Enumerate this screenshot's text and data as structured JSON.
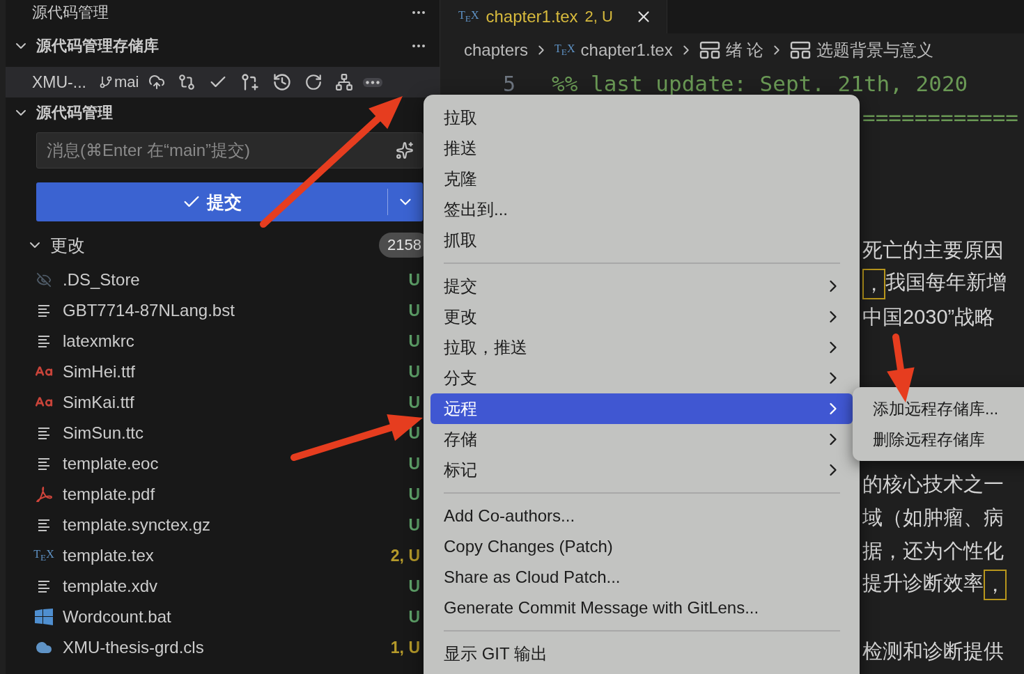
{
  "sidebar": {
    "title": "源代码管理",
    "repositories_section": {
      "title": "源代码管理存储库",
      "expanded": true
    },
    "repository": {
      "name": "XMU-...",
      "branch": "mai",
      "menu_open": true
    },
    "scm_section": {
      "title": "源代码管理",
      "expanded": true
    },
    "message_field": {
      "placeholder": "消息(⌘Enter 在“main”提交)"
    },
    "commit_button": {
      "label": "提交"
    },
    "changes": {
      "title": "更改",
      "count": "2158",
      "expanded": true,
      "files": [
        {
          "kind": "hidden",
          "name": ".DS_Store",
          "status": "U",
          "color": "#5fa36a"
        },
        {
          "kind": "text",
          "name": "GBT7714-87NLang.bst",
          "status": "U",
          "color": "#5fa36a"
        },
        {
          "kind": "text",
          "name": "latexmkrc",
          "status": "U",
          "color": "#5fa36a"
        },
        {
          "kind": "font",
          "name": "SimHei.ttf",
          "status": "U",
          "color": "#5fa36a"
        },
        {
          "kind": "font",
          "name": "SimKai.ttf",
          "status": "U",
          "color": "#5fa36a"
        },
        {
          "kind": "text",
          "name": "SimSun.ttc",
          "status": "U",
          "color": "#5fa36a"
        },
        {
          "kind": "text",
          "name": "template.eoc",
          "status": "U",
          "color": "#5fa36a"
        },
        {
          "kind": "pdf",
          "name": "template.pdf",
          "status": "U",
          "color": "#5fa36a"
        },
        {
          "kind": "text",
          "name": "template.synctex.gz",
          "status": "U",
          "color": "#5fa36a"
        },
        {
          "kind": "tex",
          "icon_text": "T$_{E}$X",
          "name": "template.tex",
          "status": "2, U",
          "color": "#b59a2a"
        },
        {
          "kind": "text",
          "name": "template.xdv",
          "status": "U",
          "color": "#5fa36a"
        },
        {
          "kind": "batch",
          "name": "Wordcount.bat",
          "status": "U",
          "color": "#5fa36a"
        },
        {
          "kind": "class",
          "name": "XMU-thesis-grd.cls",
          "status": "1, U",
          "color": "#b59a2a"
        }
      ]
    }
  },
  "editor": {
    "tabs": [
      {
        "icon_text": "T$_{E}$X",
        "name": "chapter1.tex",
        "status": "2, U",
        "selected": true
      }
    ],
    "breadcrumbs": [
      {
        "kind": "folder",
        "label": "chapters"
      },
      {
        "kind": "file",
        "icon_text": "T$_{E}$X",
        "label": "chapter1.tex"
      },
      {
        "kind": "section",
        "label": "绪 论"
      },
      {
        "kind": "section",
        "label": "选题背景与意义"
      }
    ],
    "lines": [
      {
        "kind": "code",
        "number": "5",
        "text": "%% last update: Sept. 21th, 2020"
      },
      {
        "kind": "rule",
        "text": "============"
      },
      {
        "kind": "blank"
      },
      {
        "kind": "blank"
      },
      {
        "kind": "blank"
      },
      {
        "kind": "prose",
        "segments": [
          {
            "text": "死亡的主要原因",
            "boxed": false
          }
        ]
      },
      {
        "kind": "prose",
        "segments": [
          {
            "text": "，",
            "boxed": true
          },
          {
            "text": "我国每年新增",
            "boxed": false
          }
        ]
      },
      {
        "kind": "prose",
        "segments": [
          {
            "text": "中国2030”战略",
            "boxed": false
          }
        ]
      },
      {
        "kind": "blank"
      },
      {
        "kind": "blank"
      },
      {
        "kind": "blank"
      },
      {
        "kind": "blank"
      },
      {
        "kind": "prose",
        "segments": [
          {
            "text": "的核心技术之一",
            "boxed": false
          }
        ]
      },
      {
        "kind": "prose",
        "segments": [
          {
            "text": "域（如肿瘤、病",
            "boxed": false
          }
        ]
      },
      {
        "kind": "prose",
        "segments": [
          {
            "text": "据，还为个性化",
            "boxed": false
          }
        ]
      },
      {
        "kind": "prose",
        "segments": [
          {
            "text": "提升诊断效率",
            "boxed": false
          },
          {
            "text": "，",
            "boxed": true
          }
        ]
      },
      {
        "kind": "blank"
      },
      {
        "kind": "prose",
        "segments": [
          {
            "text": "检测和诊断提供",
            "boxed": false
          }
        ]
      }
    ]
  },
  "context_menu": {
    "groups": [
      {
        "items": [
          {
            "label": "拉取",
            "submenu": false,
            "selected": false
          },
          {
            "label": "推送",
            "submenu": false,
            "selected": false
          },
          {
            "label": "克隆",
            "submenu": false,
            "selected": false
          },
          {
            "label": "签出到...",
            "submenu": false,
            "selected": false
          },
          {
            "label": "抓取",
            "submenu": false,
            "selected": false
          }
        ]
      },
      {
        "items": [
          {
            "label": "提交",
            "submenu": true,
            "selected": false
          },
          {
            "label": "更改",
            "submenu": true,
            "selected": false
          },
          {
            "label": "拉取，推送",
            "submenu": true,
            "selected": false
          },
          {
            "label": "分支",
            "submenu": true,
            "selected": false
          },
          {
            "label": "远程",
            "submenu": true,
            "selected": true
          },
          {
            "label": "存储",
            "submenu": true,
            "selected": false
          },
          {
            "label": "标记",
            "submenu": true,
            "selected": false
          }
        ]
      },
      {
        "items": [
          {
            "label": "Add Co-authors...",
            "submenu": false,
            "selected": false
          },
          {
            "label": "Copy Changes (Patch)",
            "submenu": false,
            "selected": false
          },
          {
            "label": "Share as Cloud Patch...",
            "submenu": false,
            "selected": false
          },
          {
            "label": "Generate Commit Message with GitLens...",
            "submenu": false,
            "selected": false
          }
        ]
      },
      {
        "items": [
          {
            "label": "显示 GIT 输出",
            "submenu": false,
            "selected": false
          }
        ]
      }
    ]
  },
  "submenu": {
    "items": [
      {
        "label": "添加远程存储库...",
        "selected": false
      },
      {
        "label": "删除远程存储库",
        "selected": false
      }
    ]
  }
}
